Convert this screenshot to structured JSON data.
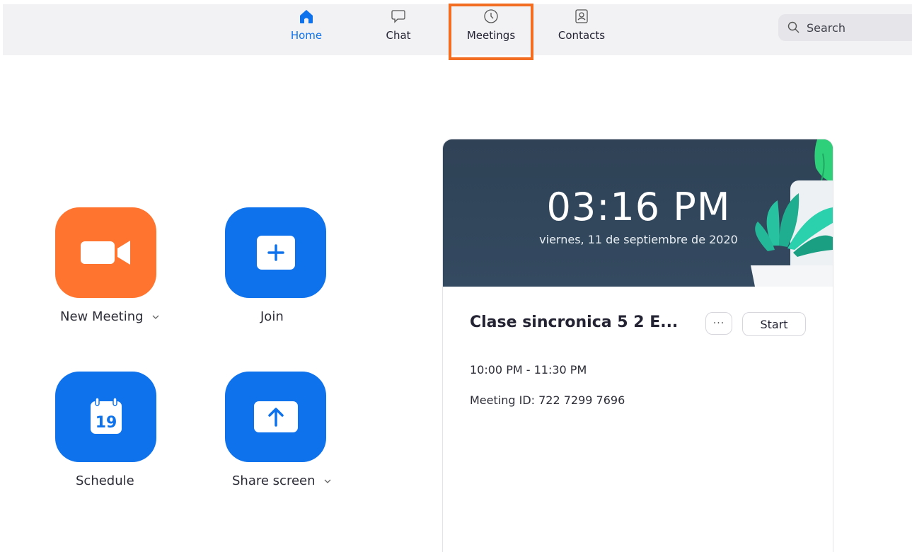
{
  "nav": {
    "tabs": [
      {
        "label": "Home",
        "icon": "home-icon",
        "active": true
      },
      {
        "label": "Chat",
        "icon": "chat-bubble-icon",
        "active": false
      },
      {
        "label": "Meetings",
        "icon": "clock-icon",
        "active": false
      },
      {
        "label": "Contacts",
        "icon": "contact-card-icon",
        "active": false
      }
    ],
    "search_placeholder": "Search"
  },
  "actions": {
    "new_meeting": {
      "label": "New Meeting",
      "icon": "video-camera-icon"
    },
    "join": {
      "label": "Join",
      "icon": "plus-icon"
    },
    "schedule": {
      "label": "Schedule",
      "icon": "calendar-icon",
      "calendar_day": "19"
    },
    "share_screen": {
      "label": "Share screen",
      "icon": "upload-arrow-icon"
    }
  },
  "card": {
    "time": "03:16 PM",
    "date": "viernes, 11 de septiembre de 2020",
    "meeting_title": "Clase sincronica 5 2 E...",
    "more_label": "···",
    "start_label": "Start",
    "meeting_time": "10:00 PM - 11:30 PM",
    "meeting_id": "Meeting ID: 722 7299 7696"
  },
  "colors": {
    "accent_blue": "#0e72ed",
    "accent_orange": "#ff742e",
    "highlight_orange": "#f26d21",
    "card_header": "#344a60"
  }
}
